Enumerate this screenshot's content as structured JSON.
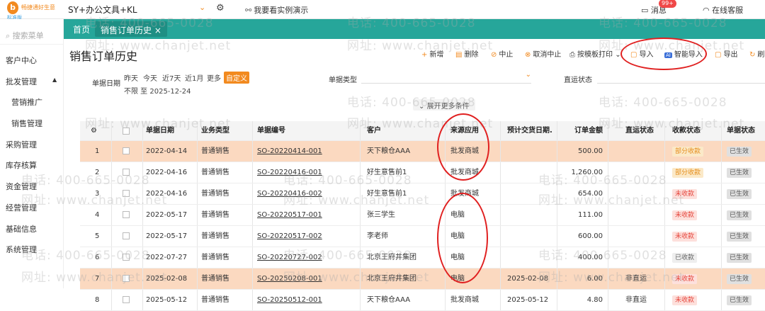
{
  "topbar": {
    "logo_name": "畅捷通好生意",
    "logo_edition": "标准版",
    "account": "SY+办公文具+KL",
    "demo": "我要看实例演示",
    "messages": "消息",
    "messages_badge": "99+",
    "service": "在线客服"
  },
  "sidebar": {
    "search_placeholder": "搜索菜单",
    "items": [
      {
        "label": "客户中心"
      },
      {
        "label": "批发管理"
      },
      {
        "label": "营销推广"
      },
      {
        "label": "销售管理"
      },
      {
        "label": "采购管理"
      },
      {
        "label": "库存核算"
      },
      {
        "label": "资金管理"
      },
      {
        "label": "经营管理"
      },
      {
        "label": "基础信息"
      },
      {
        "label": "系统管理"
      }
    ]
  },
  "tabs": {
    "home": "首页",
    "active": "销售订单历史",
    "close": "×"
  },
  "page": {
    "title": "销售订单历史",
    "toolbar": {
      "add": "新增",
      "delete": "删除",
      "stop": "中止",
      "cancel_stop": "取消中止",
      "print": "按模板打印",
      "import": "导入",
      "smart_import": "智能导入",
      "export": "导出",
      "refresh": "刷"
    }
  },
  "filters": {
    "date_label": "单据日期",
    "date_options": [
      "昨天",
      "今天",
      "近7天",
      "近1月",
      "更多"
    ],
    "date_custom": "自定义",
    "date_range": "不限 至 2025-12-24",
    "type_label": "单据类型",
    "ship_label": "直运状态",
    "expand": "展开更多条件"
  },
  "table": {
    "headers": [
      "单据日期",
      "业务类型",
      "单据编号",
      "客户",
      "来源应用",
      "预计交货日期.",
      "订单金额",
      "直运状态",
      "收款状态",
      "单据状态"
    ],
    "rows": [
      {
        "n": "1",
        "date": "2022-04-14",
        "biz": "普通销售",
        "no": "SO-20220414-001",
        "cust": "天下粮仓AAA",
        "src": "批发商城",
        "eta": "",
        "amt": "500.00",
        "ship": "",
        "pay": "部分收款",
        "status": "已生效"
      },
      {
        "n": "2",
        "date": "2022-04-16",
        "biz": "普通销售",
        "no": "SO-20220416-001",
        "cust": "好生意售前1",
        "src": "批发商城",
        "eta": "",
        "amt": "1,260.00",
        "ship": "",
        "pay": "部分收款",
        "status": "已生效"
      },
      {
        "n": "3",
        "date": "2022-04-16",
        "biz": "普通销售",
        "no": "SO-20220416-002",
        "cust": "好生意售前1",
        "src": "批发商城",
        "eta": "",
        "amt": "654.00",
        "ship": "",
        "pay": "未收款",
        "status": "已生效"
      },
      {
        "n": "4",
        "date": "2022-05-17",
        "biz": "普通销售",
        "no": "SO-20220517-001",
        "cust": "张三学生",
        "src": "电脑",
        "eta": "",
        "amt": "111.00",
        "ship": "",
        "pay": "未收款",
        "status": "已生效"
      },
      {
        "n": "5",
        "date": "2022-05-17",
        "biz": "普通销售",
        "no": "SO-20220517-002",
        "cust": "李老师",
        "src": "电脑",
        "eta": "",
        "amt": "600.00",
        "ship": "",
        "pay": "未收款",
        "status": "已生效"
      },
      {
        "n": "6",
        "date": "2022-07-27",
        "biz": "普通销售",
        "no": "SO-20220727-002",
        "cust": "北京王府井集团",
        "src": "电脑",
        "eta": "",
        "amt": "400.00",
        "ship": "",
        "pay": "已收款",
        "status": "已生效"
      },
      {
        "n": "7",
        "date": "2025-02-08",
        "biz": "普通销售",
        "no": "SO-20250208-001",
        "cust": "北京王府井集团",
        "src": "电脑",
        "eta": "2025-02-08",
        "amt": "6.00",
        "ship": "非直运",
        "pay": "未收款",
        "status": "已生效"
      },
      {
        "n": "8",
        "date": "2025-05-12",
        "biz": "普通销售",
        "no": "SO-20250512-001",
        "cust": "天下粮仓AAA",
        "src": "批发商城",
        "eta": "2025-05-12",
        "amt": "4.80",
        "ship": "非直运",
        "pay": "未收款",
        "status": "已生效"
      }
    ]
  },
  "watermark": {
    "phone": "电话: 400-665-0028",
    "site": "网址: www.chanjet.net"
  }
}
